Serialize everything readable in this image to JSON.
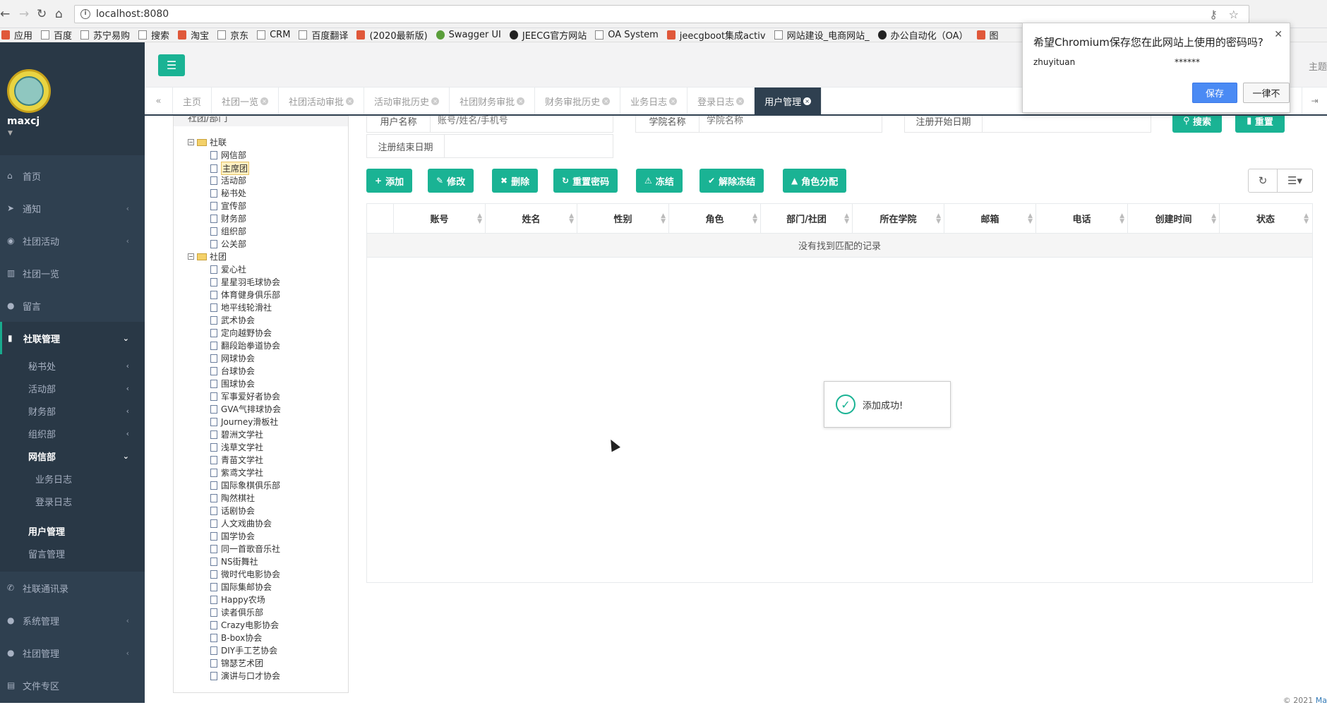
{
  "browser": {
    "url": "localhost:8080",
    "bookmarks": [
      "应用",
      "百度",
      "苏宁易购",
      "搜索",
      "淘宝",
      "京东",
      "CRM",
      "百度翻译",
      "(2020最新版)",
      "Swagger UI",
      "JEECG官方网站",
      "OA System",
      "jeecgboot集成activ",
      "网站建设_电商网站_",
      "办公自动化（OA）",
      "图"
    ]
  },
  "password_popup": {
    "title": "希望Chromium保存您在此网站上使用的密码吗?",
    "username": "zhuyituan",
    "password_mask": "******",
    "save_label": "保存",
    "never_label": "一律不"
  },
  "sidebar": {
    "user": "maxcj",
    "items": [
      {
        "label": "首页",
        "icon": "home-icon"
      },
      {
        "label": "通知",
        "icon": "paper-plane-icon"
      },
      {
        "label": "社团活动",
        "icon": "globe-icon"
      },
      {
        "label": "社团一览",
        "icon": "bank-icon"
      },
      {
        "label": "留言",
        "icon": "comment-icon"
      },
      {
        "label": "社联管理",
        "icon": "bookmark-icon"
      }
    ],
    "sub_items": [
      {
        "label": "秘书处"
      },
      {
        "label": "活动部"
      },
      {
        "label": "财务部"
      },
      {
        "label": "组织部"
      },
      {
        "label": "网信部"
      }
    ],
    "sub_sub_items": [
      {
        "label": "业务日志"
      },
      {
        "label": "登录日志"
      }
    ],
    "sub_items2": [
      {
        "label": "用户管理"
      },
      {
        "label": "留言管理"
      }
    ],
    "items_bottom": [
      {
        "label": "社联通讯录",
        "icon": "phone-icon"
      },
      {
        "label": "系统管理",
        "icon": "user-icon"
      },
      {
        "label": "社团管理",
        "icon": "users-icon"
      },
      {
        "label": "文件专区",
        "icon": "folder-icon"
      }
    ]
  },
  "topbar": {
    "theme_label": "主题"
  },
  "tabs": [
    "主页",
    "社团一览",
    "社团活动审批",
    "活动审批历史",
    "社团财务审批",
    "财务审批历史",
    "业务日志",
    "登录日志",
    "用户管理"
  ],
  "tree": {
    "title": "社团/部门",
    "root1": "社联",
    "root1_children": [
      "网信部",
      "主席团",
      "活动部",
      "秘书处",
      "宣传部",
      "财务部",
      "组织部",
      "公关部"
    ],
    "root2": "社团",
    "root2_children": [
      "爱心社",
      "星星羽毛球协会",
      "体育健身俱乐部",
      "地平线轮滑社",
      "武术协会",
      "定向越野协会",
      "翻段跆拳道协会",
      "网球协会",
      "台球协会",
      "围球协会",
      "军事爱好者协会",
      "GVA气排球协会",
      "Journey滑板社",
      "碧洲文学社",
      "浅草文学社",
      "青苗文学社",
      "紫鸢文学社",
      "国际象棋俱乐部",
      "陶然棋社",
      "话剧协会",
      "人文戏曲协会",
      "国学协会",
      "同一首歌音乐社",
      "NS街舞社",
      "微时代电影协会",
      "国际集邮协会",
      "Happy农场",
      "读者俱乐部",
      "Crazy电影协会",
      "B-box协会",
      "DIY手工艺协会",
      "锦瑟艺术团",
      "演讲与口才协会"
    ]
  },
  "search": {
    "username_label": "用户名称",
    "username_placeholder": "账号/姓名/手机号",
    "college_label": "学院名称",
    "college_placeholder": "学院名称",
    "reg_start_label": "注册开始日期",
    "reg_end_label": "注册结束日期",
    "search_btn": "搜索",
    "reset_btn": "重置"
  },
  "toolbar": {
    "add": "添加",
    "edit": "修改",
    "delete": "删除",
    "reset_pwd": "重置密码",
    "freeze": "冻结",
    "unfreeze": "解除冻结",
    "role": "角色分配"
  },
  "table": {
    "headers": [
      "账号",
      "姓名",
      "性别",
      "角色",
      "部门/社团",
      "所在学院",
      "邮箱",
      "电话",
      "创建时间",
      "状态"
    ],
    "empty_text": "没有找到匹配的记录"
  },
  "toast": {
    "text": "添加成功!"
  },
  "footer": {
    "prefix": "© 2021 ",
    "brand": "Ma"
  }
}
